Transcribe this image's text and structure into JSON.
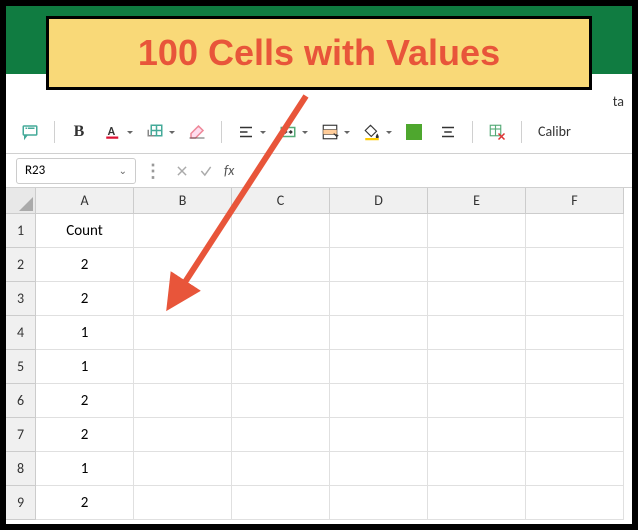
{
  "callout_text": "100 Cells with Values",
  "tab_visible_text": "ta",
  "name_box": "R23",
  "formula_input": "",
  "fx_label": "fx",
  "font_name": "Calibr",
  "columns": [
    "A",
    "B",
    "C",
    "D",
    "E",
    "F"
  ],
  "rows": [
    {
      "num": "1",
      "a": "Count"
    },
    {
      "num": "2",
      "a": "2"
    },
    {
      "num": "3",
      "a": "2"
    },
    {
      "num": "4",
      "a": "1"
    },
    {
      "num": "5",
      "a": "1"
    },
    {
      "num": "6",
      "a": "2"
    },
    {
      "num": "7",
      "a": "2"
    },
    {
      "num": "8",
      "a": "1"
    },
    {
      "num": "9",
      "a": "2"
    }
  ]
}
